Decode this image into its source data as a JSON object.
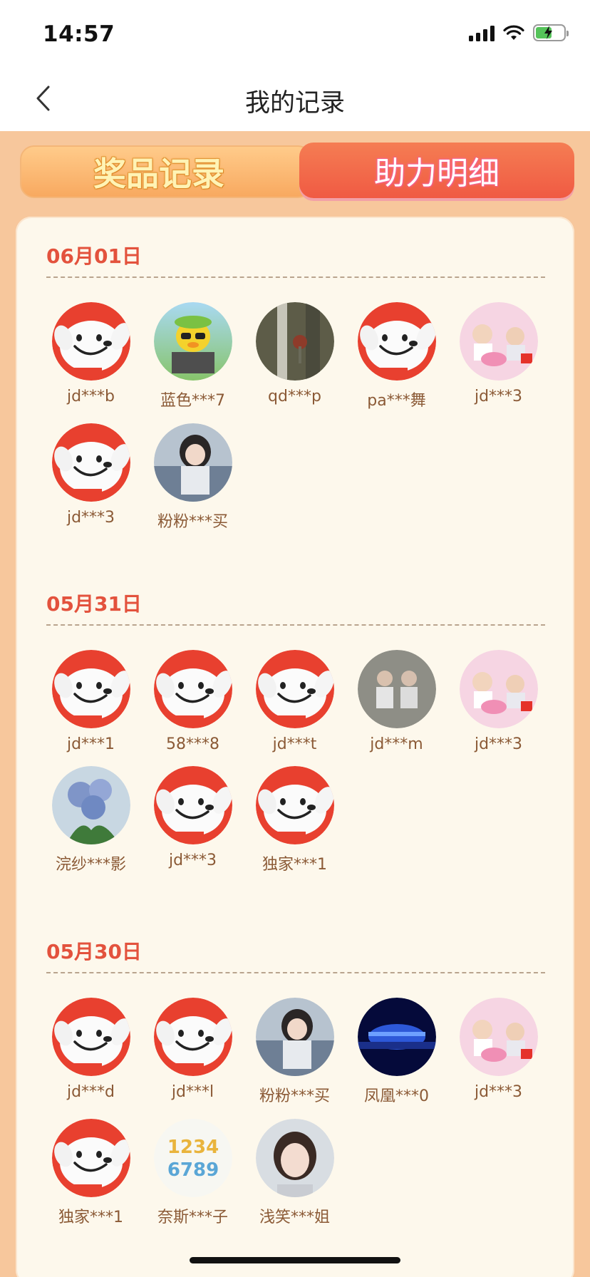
{
  "status_bar": {
    "time": "14:57"
  },
  "nav": {
    "title": "我的记录"
  },
  "tabs": [
    {
      "label": "奖品记录",
      "active": false
    },
    {
      "label": "助力明细",
      "active": true
    }
  ],
  "sections": [
    {
      "date": "06月01日",
      "users": [
        {
          "name": "jd***b",
          "avatar": "jd-mascot"
        },
        {
          "name": "蓝色***7",
          "avatar": "cartoon-duck"
        },
        {
          "name": "qd***p",
          "avatar": "photo-dark"
        },
        {
          "name": "pa***舞",
          "avatar": "jd-mascot"
        },
        {
          "name": "jd***3",
          "avatar": "photo-pink"
        },
        {
          "name": "jd***3",
          "avatar": "jd-mascot"
        },
        {
          "name": "粉粉***买",
          "avatar": "photo-girl"
        }
      ]
    },
    {
      "date": "05月31日",
      "users": [
        {
          "name": "jd***1",
          "avatar": "jd-mascot"
        },
        {
          "name": "58***8",
          "avatar": "jd-mascot"
        },
        {
          "name": "jd***t",
          "avatar": "jd-mascot"
        },
        {
          "name": "jd***m",
          "avatar": "photo-family"
        },
        {
          "name": "jd***3",
          "avatar": "photo-pink"
        },
        {
          "name": "浣纱***影",
          "avatar": "photo-flowers"
        },
        {
          "name": "jd***3",
          "avatar": "jd-mascot"
        },
        {
          "name": "独家***1",
          "avatar": "jd-mascot"
        }
      ]
    },
    {
      "date": "05月30日",
      "users": [
        {
          "name": "jd***d",
          "avatar": "jd-mascot"
        },
        {
          "name": "jd***l",
          "avatar": "jd-mascot"
        },
        {
          "name": "粉粉***买",
          "avatar": "photo-girl"
        },
        {
          "name": "凤凰***0",
          "avatar": "photo-blue-fountain"
        },
        {
          "name": "jd***3",
          "avatar": "photo-pink"
        },
        {
          "name": "独家***1",
          "avatar": "jd-mascot"
        },
        {
          "name": "奈斯***子",
          "avatar": "photo-numbers"
        },
        {
          "name": "浅笑***姐",
          "avatar": "photo-portrait"
        }
      ]
    }
  ],
  "colors": {
    "page_bg": "#f7c79c",
    "card_bg": "#fdf8ec",
    "date_text": "#e3523d",
    "username_text": "#8b5a36",
    "active_tab": "#f05a43"
  }
}
